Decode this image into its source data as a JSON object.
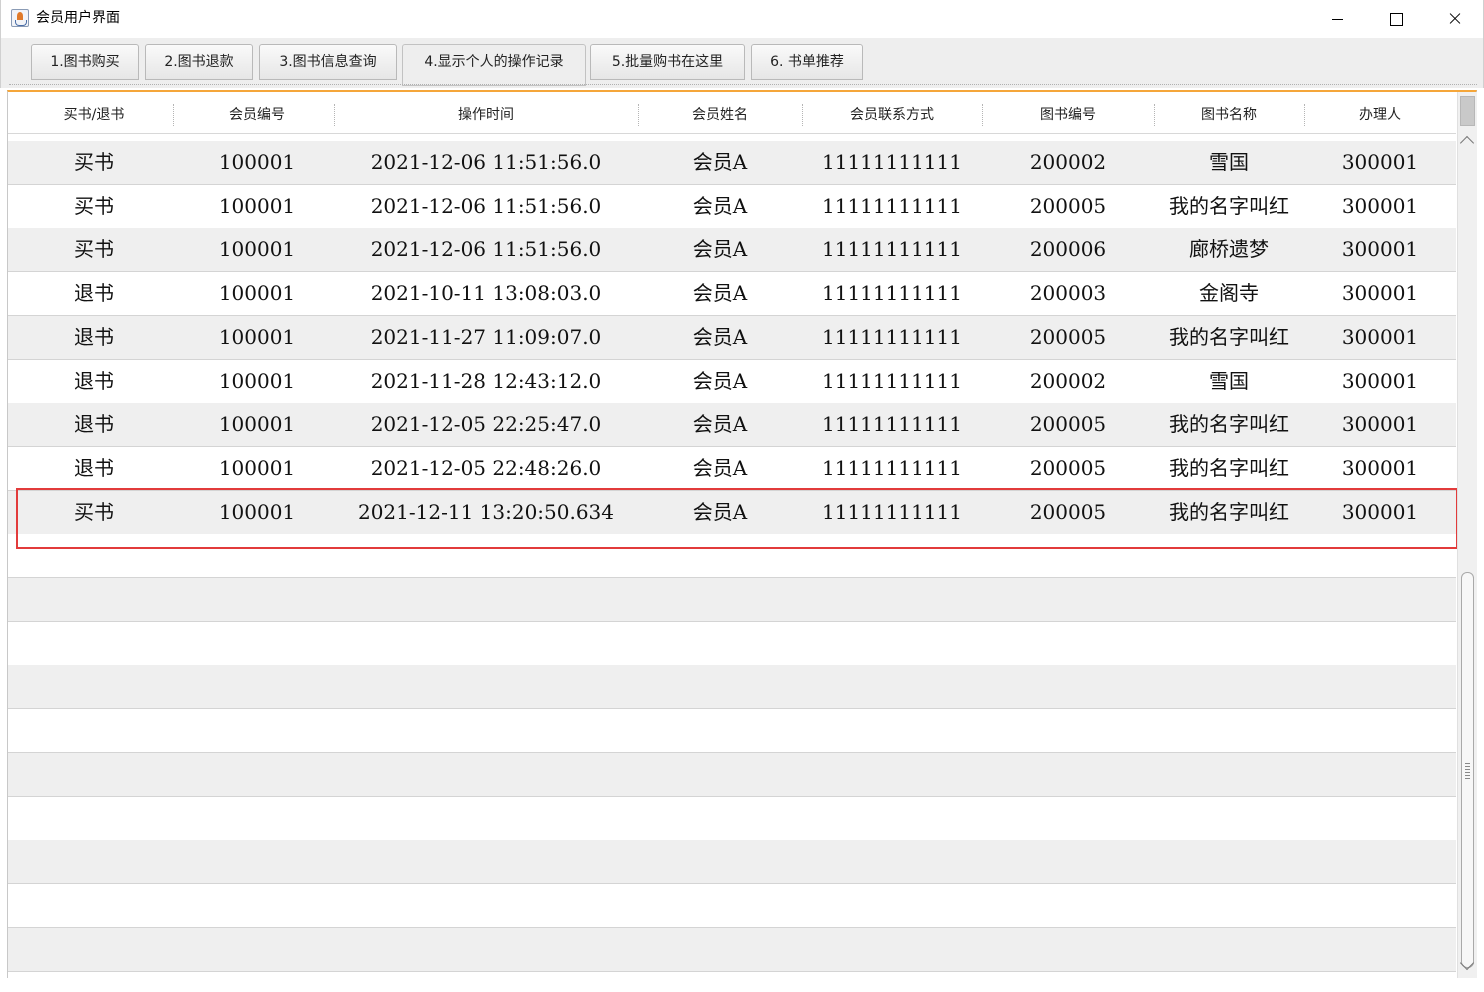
{
  "window": {
    "title": "会员用户界面"
  },
  "tabs": [
    {
      "label": "1.图书购买"
    },
    {
      "label": "2.图书退款"
    },
    {
      "label": "3.图书信息查询"
    },
    {
      "label": "4.显示个人的操作记录"
    },
    {
      "label": "5.批量购书在这里"
    },
    {
      "label": "6. 书单推荐"
    }
  ],
  "active_tab": "4.显示个人的操作记录",
  "table": {
    "columns": [
      "买书/退书",
      "会员编号",
      "操作时间",
      "会员姓名",
      "会员联系方式",
      "图书编号",
      "图书名称",
      "办理人"
    ],
    "rows": [
      [
        "买书",
        "100001",
        "2021-12-06 11:51:56.0",
        "会员A",
        "11111111111",
        "200002",
        "雪国",
        "300001"
      ],
      [
        "买书",
        "100001",
        "2021-12-06 11:51:56.0",
        "会员A",
        "11111111111",
        "200005",
        "我的名字叫红",
        "300001"
      ],
      [
        "买书",
        "100001",
        "2021-12-06 11:51:56.0",
        "会员A",
        "11111111111",
        "200006",
        "廊桥遗梦",
        "300001"
      ],
      [
        "退书",
        "100001",
        "2021-10-11 13:08:03.0",
        "会员A",
        "11111111111",
        "200003",
        "金阁寺",
        "300001"
      ],
      [
        "退书",
        "100001",
        "2021-11-27 11:09:07.0",
        "会员A",
        "11111111111",
        "200005",
        "我的名字叫红",
        "300001"
      ],
      [
        "退书",
        "100001",
        "2021-11-28 12:43:12.0",
        "会员A",
        "11111111111",
        "200002",
        "雪国",
        "300001"
      ],
      [
        "退书",
        "100001",
        "2021-12-05 22:25:47.0",
        "会员A",
        "11111111111",
        "200005",
        "我的名字叫红",
        "300001"
      ],
      [
        "退书",
        "100001",
        "2021-12-05 22:48:26.0",
        "会员A",
        "11111111111",
        "200005",
        "我的名字叫红",
        "300001"
      ],
      [
        "买书",
        "100001",
        "2021-12-11 13:20:50.634",
        "会员A",
        "11111111111",
        "200005",
        "我的名字叫红",
        "300001"
      ]
    ],
    "empty_rows": 10,
    "highlighted_row_index": 8
  },
  "colors": {
    "accent": "#f5a63a",
    "highlight_border": "#e23b3b",
    "row_stripe": "#efefef"
  }
}
